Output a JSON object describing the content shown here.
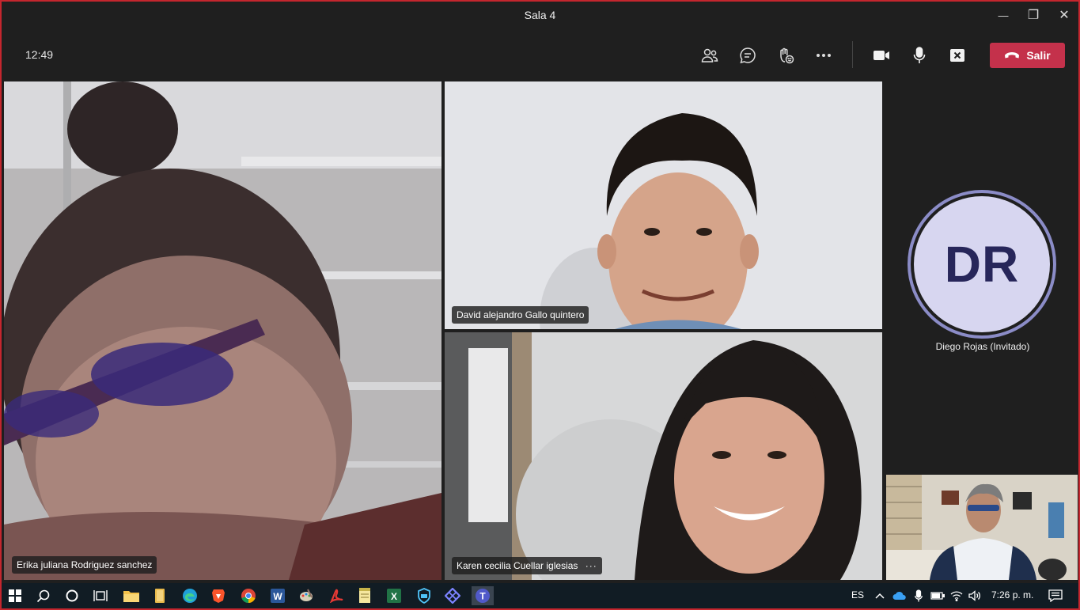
{
  "window": {
    "title": "Sala 4",
    "minimize_glyph": "—",
    "restore_glyph": "❐",
    "close_glyph": "✕"
  },
  "toolbar": {
    "clock": "12:49",
    "buttons": [
      "participants-icon",
      "chat-icon",
      "reactions-icon",
      "more-options-icon",
      "camera-icon",
      "microphone-icon",
      "share-screen-icon"
    ],
    "leave_label": "Salir",
    "leave_color": "#c4314b"
  },
  "participants": [
    {
      "name": "Erika juliana Rodriguez sanchez"
    },
    {
      "name": "David alejandro Gallo quintero"
    },
    {
      "name": "Karen cecilia Cuellar iglesias",
      "more": "···"
    },
    {
      "name": "Diego Rojas (Invitado)",
      "initials": "DR"
    }
  ],
  "taskbar": {
    "apps": [
      "windows-start-icon",
      "search-icon",
      "cortana-icon",
      "task-view-icon",
      "file-explorer-icon",
      "files-icon",
      "edge-icon",
      "brave-icon",
      "chrome-icon",
      "word-icon",
      "paint-icon",
      "acrobat-icon",
      "notes-icon",
      "excel-icon",
      "defender-icon",
      "vpn-icon",
      "teams-icon"
    ],
    "language": "ES",
    "time": "7:26 p. m."
  },
  "colors": {
    "accent_border": "#c4262e",
    "avatar_ring": "#8b8cc7",
    "avatar_bg": "#d7d6f0",
    "avatar_text": "#27265a"
  }
}
